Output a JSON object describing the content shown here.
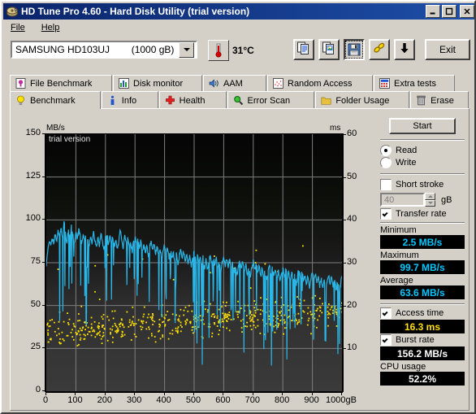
{
  "window": {
    "title": "HD Tune Pro 4.60 - Hard Disk Utility (trial version)",
    "icon": "hdtune-app-icon",
    "minimize_label": "_",
    "maximize_label": "□",
    "close_label": "✕",
    "titlebar_color": "#0a246a"
  },
  "menu": {
    "items": [
      {
        "label": "File"
      },
      {
        "label": "Help"
      }
    ]
  },
  "toolbar": {
    "drive": "SAMSUNG HD103UJ        (1000 gB)",
    "temperature": "31°C",
    "thermometer_icon": "thermometer-icon",
    "buttons": [
      {
        "name": "copy-text-button",
        "icon": "copy-text-icon",
        "pressed": false
      },
      {
        "name": "copy-image-button",
        "icon": "copy-image-icon",
        "pressed": false
      },
      {
        "name": "save-button",
        "icon": "floppy-save-icon",
        "pressed": true
      },
      {
        "name": "link-button",
        "icon": "chain-link-icon",
        "pressed": false
      },
      {
        "name": "download-button",
        "icon": "down-arrow-icon",
        "pressed": false
      }
    ],
    "exit_label": "Exit"
  },
  "tabs": {
    "top_row": [
      {
        "label": "File Benchmark",
        "icon": "file-benchmark-icon"
      },
      {
        "label": "Disk monitor",
        "icon": "disk-monitor-icon"
      },
      {
        "label": "AAM",
        "icon": "speaker-icon"
      },
      {
        "label": "Random Access",
        "icon": "random-access-icon"
      },
      {
        "label": "Extra tests",
        "icon": "extra-tests-icon"
      }
    ],
    "bottom_row": [
      {
        "label": "Benchmark",
        "icon": "lightbulb-icon",
        "active": true
      },
      {
        "label": "Info",
        "icon": "info-icon",
        "active": false
      },
      {
        "label": "Health",
        "icon": "health-cross-icon",
        "active": false
      },
      {
        "label": "Error Scan",
        "icon": "magnifier-icon",
        "active": false
      },
      {
        "label": "Folder Usage",
        "icon": "folder-icon",
        "active": false
      },
      {
        "label": "Erase",
        "icon": "trash-icon",
        "active": false
      }
    ]
  },
  "controls": {
    "start_label": "Start",
    "read_label": "Read",
    "write_label": "Write",
    "read_selected": true,
    "short_stroke_label": "Short stroke",
    "short_stroke_checked": false,
    "short_stroke_value": "40",
    "short_stroke_unit": "gB",
    "transfer_rate_label": "Transfer rate",
    "transfer_rate_checked": true,
    "access_time_label": "Access time",
    "access_time_checked": true,
    "burst_rate_label": "Burst rate",
    "burst_rate_checked": true
  },
  "results": {
    "minimum_label": "Minimum",
    "minimum_value": "2.5 MB/s",
    "maximum_label": "Maximum",
    "maximum_value": "99.7 MB/s",
    "average_label": "Average",
    "average_value": "63.6 MB/s",
    "access_time_value": "16.3 ms",
    "burst_rate_value": "156.2 MB/s",
    "cpu_usage_label": "CPU usage",
    "cpu_usage_value": "52.2%"
  },
  "chart_data": {
    "type": "line",
    "title": "",
    "watermark": "trial version",
    "xlabel": "gB",
    "ylabel": "MB/s",
    "y2label": "ms",
    "xlim": [
      0,
      1000
    ],
    "ylim": [
      0,
      150
    ],
    "y2lim": [
      0,
      60
    ],
    "grid": true,
    "xticks": [
      0,
      100,
      200,
      300,
      400,
      500,
      600,
      700,
      800,
      900,
      1000
    ],
    "xticklabels": [
      "0",
      "100",
      "200",
      "300",
      "400",
      "500",
      "600",
      "700",
      "800",
      "900",
      "1000gB"
    ],
    "yticks": [
      0,
      25,
      50,
      75,
      100,
      125,
      150
    ],
    "yticklabels": [
      "0",
      "25",
      "50",
      "75",
      "100",
      "125",
      "150"
    ],
    "y2ticks": [
      10,
      20,
      30,
      40,
      50,
      60
    ],
    "y2ticklabels": [
      "10",
      "20",
      "30",
      "40",
      "50",
      "60"
    ],
    "series": [
      {
        "name": "Transfer rate",
        "color": "#29b6e8",
        "unit": "MB/s",
        "axis": "left",
        "x": [
          0,
          5,
          10,
          15,
          20,
          25,
          30,
          35,
          40,
          45,
          50,
          55,
          60,
          65,
          70,
          75,
          80,
          85,
          90,
          95,
          100,
          105,
          110,
          115,
          120,
          125,
          130,
          135,
          140,
          145,
          150,
          155,
          160,
          165,
          170,
          175,
          180,
          185,
          190,
          195,
          200,
          205,
          210,
          215,
          220,
          225,
          230,
          235,
          240,
          245,
          250,
          255,
          260,
          265,
          270,
          275,
          280,
          285,
          290,
          295,
          300,
          305,
          310,
          315,
          320,
          325,
          330,
          335,
          340,
          345,
          350,
          355,
          360,
          365,
          370,
          375,
          380,
          385,
          390,
          395,
          400,
          405,
          410,
          415,
          420,
          425,
          430,
          435,
          440,
          445,
          450,
          455,
          460,
          465,
          470,
          475,
          480,
          485,
          490,
          495,
          500,
          505,
          510,
          515,
          520,
          525,
          530,
          535,
          540,
          545,
          550,
          555,
          560,
          565,
          570,
          575,
          580,
          585,
          590,
          595,
          600,
          605,
          610,
          615,
          620,
          625,
          630,
          635,
          640,
          645,
          650,
          655,
          660,
          665,
          670,
          675,
          680,
          685,
          690,
          695,
          700,
          705,
          710,
          715,
          720,
          725,
          730,
          735,
          740,
          745,
          750,
          755,
          760,
          765,
          770,
          775,
          780,
          785,
          790,
          795,
          800,
          805,
          810,
          815,
          820,
          825,
          830,
          835,
          840,
          845,
          850,
          855,
          860,
          865,
          870,
          875,
          880,
          885,
          890,
          895,
          900,
          905,
          910,
          915,
          920,
          925,
          930,
          935,
          940,
          945,
          950,
          955,
          960,
          965,
          970,
          975,
          980,
          985,
          990,
          995,
          1000
        ],
        "y": [
          73,
          83,
          88,
          85,
          90,
          86,
          92,
          88,
          94,
          90,
          96,
          88,
          99,
          92,
          86,
          95,
          89,
          97,
          91,
          86,
          93,
          88,
          95,
          90,
          86,
          92,
          88,
          94,
          89,
          84,
          91,
          86,
          93,
          88,
          83,
          90,
          85,
          92,
          87,
          82,
          89,
          92,
          86,
          91,
          85,
          90,
          84,
          89,
          83,
          88,
          95,
          89,
          83,
          92,
          86,
          90,
          84,
          88,
          82,
          87,
          91,
          85,
          89,
          83,
          88,
          82,
          86,
          80,
          85,
          79,
          84,
          88,
          82,
          86,
          80,
          85,
          79,
          83,
          77,
          82,
          86,
          80,
          84,
          78,
          83,
          77,
          81,
          75,
          80,
          74,
          79,
          83,
          77,
          82,
          76,
          80,
          74,
          79,
          73,
          78,
          82,
          76,
          81,
          75,
          79,
          73,
          78,
          72,
          77,
          71,
          76,
          80,
          74,
          79,
          73,
          78,
          72,
          76,
          70,
          75,
          79,
          73,
          78,
          72,
          77,
          71,
          75,
          69,
          74,
          68,
          73,
          77,
          71,
          76,
          70,
          74,
          68,
          73,
          67,
          72,
          76,
          70,
          75,
          69,
          73,
          67,
          72,
          66,
          71,
          65,
          70,
          74,
          68,
          73,
          67,
          71,
          65,
          70,
          64,
          69,
          73,
          67,
          72,
          66,
          70,
          64,
          69,
          63,
          68,
          62,
          67,
          71,
          65,
          70,
          64,
          68,
          62,
          67,
          61,
          66,
          70,
          64,
          69,
          63,
          67,
          61,
          66,
          60,
          65,
          59,
          64,
          68,
          62,
          67,
          61,
          65,
          59,
          64,
          58,
          63,
          67
        ]
      },
      {
        "name": "Access time",
        "color": "#ffe000",
        "unit": "ms",
        "axis": "right",
        "marker": "dot",
        "mean_ms": 16.3,
        "note": "scatter of ~500 random access samples, mostly 10-25 ms, rising slightly with position"
      }
    ]
  }
}
